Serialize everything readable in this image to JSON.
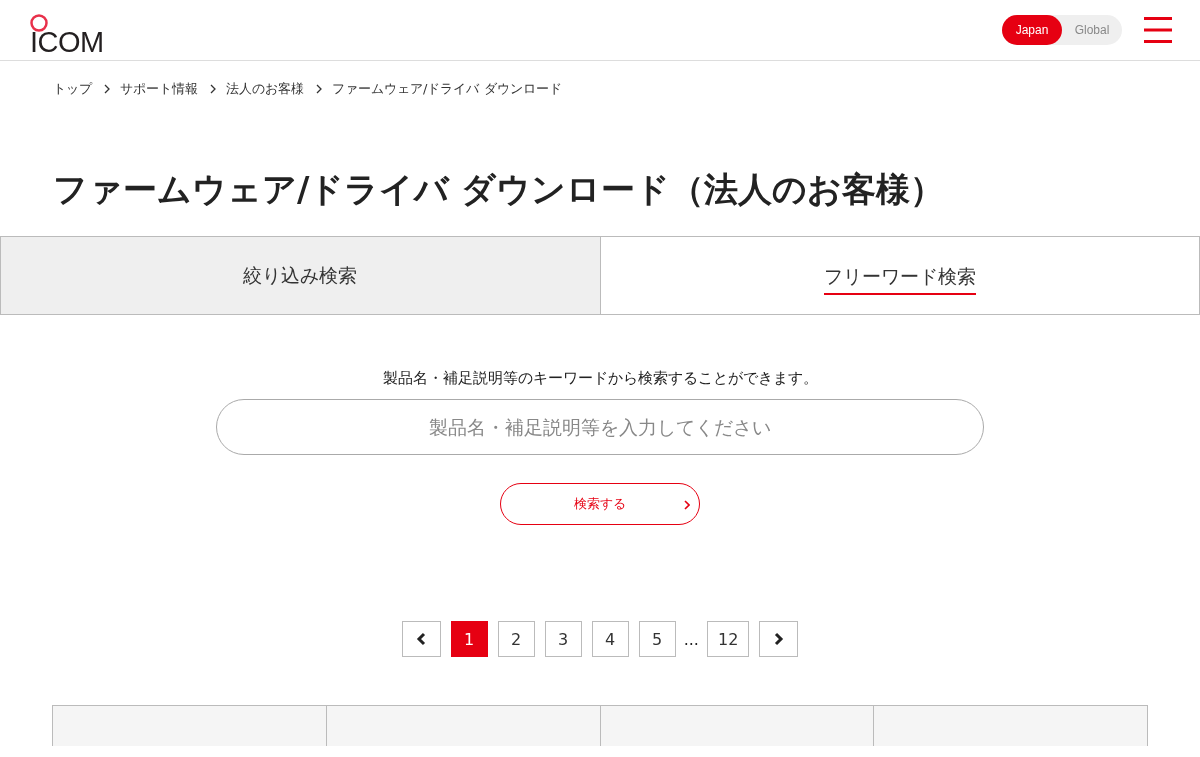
{
  "header": {
    "logo": "ICOM",
    "region_switch": [
      {
        "label": "Japan",
        "selected": true
      },
      {
        "label": "Global",
        "selected": false
      }
    ]
  },
  "breadcrumb": [
    "トップ",
    "サポート情報",
    "法人のお客様",
    "ファームウェア/ドライバ ダウンロード"
  ],
  "title": "ファームウェア/ドライバ ダウンロード（法人のお客様）",
  "tabs": [
    {
      "label": "絞り込み検索",
      "selected": false
    },
    {
      "label": "フリーワード検索",
      "selected": true
    }
  ],
  "search": {
    "description": "製品名・補足説明等のキーワードから検索することができます。",
    "placeholder": "製品名・補足説明等を入力してください",
    "button": "検索する"
  },
  "pagination": [
    {
      "kind": "prev"
    },
    {
      "kind": "page",
      "label": "1",
      "selected": true
    },
    {
      "kind": "page",
      "label": "2",
      "selected": false
    },
    {
      "kind": "page",
      "label": "3",
      "selected": false
    },
    {
      "kind": "page",
      "label": "4",
      "selected": false
    },
    {
      "kind": "page",
      "label": "5",
      "selected": false
    },
    {
      "kind": "gap",
      "label": "..."
    },
    {
      "kind": "page",
      "label": "12",
      "selected": false
    },
    {
      "kind": "next"
    }
  ],
  "table": {
    "header_cells": [
      {
        "kind": "cell"
      },
      {
        "kind": "cell"
      },
      {
        "kind": "cell"
      },
      {
        "kind": "cell"
      }
    ]
  }
}
